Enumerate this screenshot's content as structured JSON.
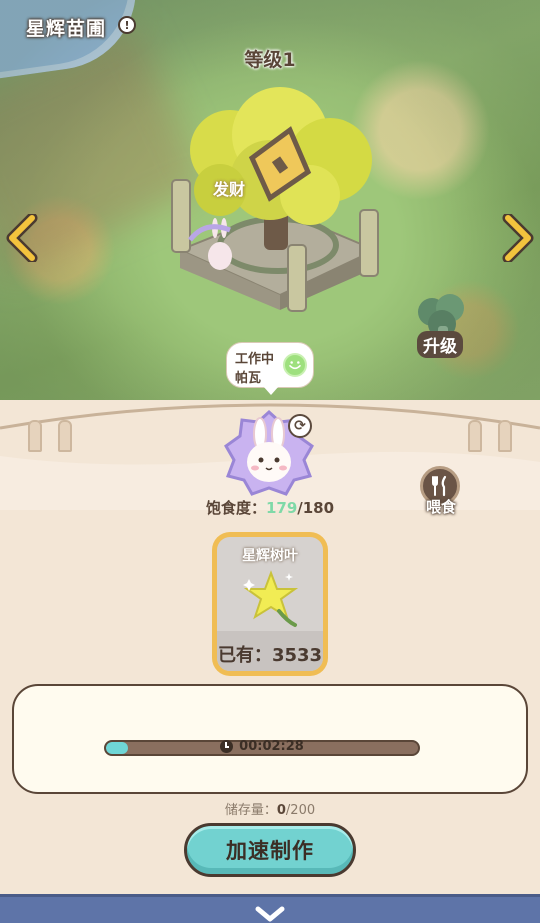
{
  "header": {
    "title": "星辉苗圃",
    "info_icon": "!"
  },
  "level_label": "等级1",
  "scene": {
    "sparkle_text": "发财"
  },
  "upgrade": {
    "label": "升级"
  },
  "worker": {
    "status": "工作中",
    "name": "帕瓦"
  },
  "satiety": {
    "label": "饱食度：",
    "current": "179",
    "max": "/180"
  },
  "feed": {
    "label": "喂食"
  },
  "product": {
    "name": "星辉树叶",
    "owned_label": "已有：",
    "owned_value": "3533"
  },
  "production": {
    "time_left": "00:02:28",
    "progress": 0.07
  },
  "storage": {
    "label": "储存量：",
    "current": "0",
    "max": "/200"
  },
  "speed_button": {
    "label": "加速制作"
  },
  "colors": {
    "accent_teal": "#72d2d0",
    "panel_bg": "#f3e6d6",
    "text_brown": "#5a4638",
    "satiety_green": "#7fd9a8",
    "card_gold": "#f0bd54"
  },
  "icons": [
    "info-icon",
    "arrow-left-icon",
    "arrow-right-icon",
    "tree-icon",
    "broccoli-icon",
    "smile-icon",
    "rabbit-avatar",
    "swap-icon",
    "fork-knife-icon",
    "star-leaf-icon",
    "clock-icon",
    "chevron-down-icon"
  ]
}
